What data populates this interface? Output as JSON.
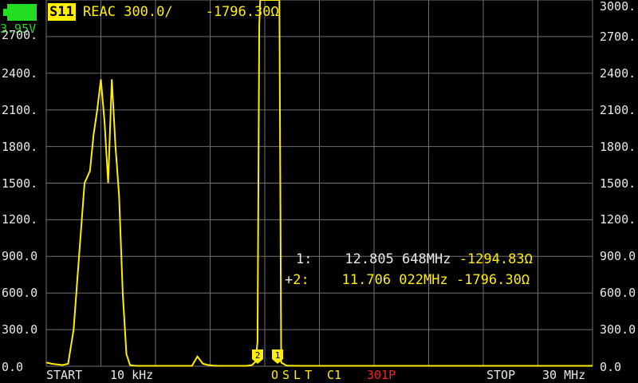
{
  "status": {
    "battery_voltage": "3.95V",
    "battery_color": "#22dd22"
  },
  "trace": {
    "channel": "S11",
    "format": "REAC",
    "scale": "300.0/",
    "value": "-1796.30Ω",
    "color": "#ffee00"
  },
  "y_axis": {
    "left_ticks": [
      "2700.",
      "2400.",
      "2100.",
      "1800.",
      "1500.",
      "1200.",
      "900.0",
      "600.0",
      "300.0",
      "0.0"
    ],
    "right_ticks": [
      "3000.",
      "2700.",
      "2400.",
      "2100.",
      "1800.",
      "1500.",
      "1200.",
      "900.0",
      "600.0",
      "300.0",
      "0.0"
    ]
  },
  "markers": [
    {
      "label": "1:",
      "frequency": "12.805 648MHz",
      "value": "-1294.83Ω",
      "active": false
    },
    {
      "label": "2:",
      "frequency": "11.706 022MHz",
      "value": "-1796.30Ω",
      "active": true,
      "prefix": "+"
    }
  ],
  "marker_flags": [
    "2",
    "1"
  ],
  "bottom_bar": {
    "start_label": "START",
    "start_value": "10 kHz",
    "cal_status": "OSLT",
    "cal_slot": "C1",
    "points": "301P",
    "stop_label": "STOP",
    "stop_value": "30 MHz"
  },
  "colors": {
    "trace": "#ffee00",
    "grid": "#707070",
    "points": "#ff2020",
    "text": "#e8e8e8"
  },
  "chart_data": {
    "type": "line",
    "ylim": [
      0,
      3000
    ],
    "x_range": [
      "10 kHz",
      "30 MHz"
    ],
    "x_unit": "MHz",
    "grid": true,
    "series": [
      {
        "x": [
          0.01,
          0.3,
          0.6,
          0.9,
          1.2,
          1.5,
          1.8,
          2.1,
          2.4,
          2.6,
          2.8,
          3.0,
          3.2,
          3.4,
          3.6,
          3.8,
          4.0,
          4.2,
          4.4,
          4.6,
          4.8,
          5.0,
          5.5,
          6.0,
          6.5,
          7.0,
          7.5,
          8.0,
          8.3,
          8.6,
          8.9,
          9.2,
          9.5,
          10.0,
          10.5,
          11.0,
          11.3,
          11.5,
          11.6,
          11.65,
          11.7,
          11.75,
          11.8,
          12.0,
          12.3,
          12.5,
          12.7,
          12.8,
          12.9,
          13.2,
          14,
          16,
          18,
          20,
          22,
          24,
          26,
          28,
          30
        ],
        "values": [
          30,
          20,
          15,
          10,
          20,
          300,
          900,
          1500,
          1600,
          1900,
          2100,
          2350,
          2000,
          1500,
          2350,
          1800,
          1400,
          600,
          100,
          10,
          5,
          3,
          3,
          3,
          3,
          3,
          3,
          3,
          80,
          20,
          10,
          5,
          3,
          3,
          3,
          3,
          10,
          40,
          200,
          1500,
          2800,
          3000,
          3000,
          3000,
          3000,
          3000,
          3000,
          3000,
          30,
          5,
          3,
          3,
          3,
          3,
          3,
          3,
          3,
          3,
          3
        ]
      }
    ]
  }
}
